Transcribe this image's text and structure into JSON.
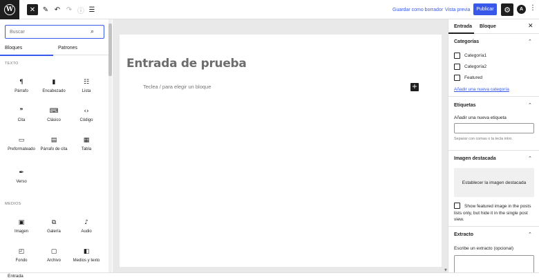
{
  "toolbar": {
    "save_draft": "Guardar como borrador",
    "preview": "Vista previa",
    "publish": "Publicar",
    "avatar_letter": "A"
  },
  "inserter": {
    "search_placeholder": "Buscar",
    "tabs": [
      "Bloques",
      "Patrones"
    ],
    "categories": {
      "text": "TEXTO",
      "media": "MEDIOS"
    },
    "text_blocks": [
      {
        "label": "Párrafo",
        "icon": "paragraph-icon"
      },
      {
        "label": "Encabezado",
        "icon": "bookmark-icon"
      },
      {
        "label": "Lista",
        "icon": "list-icon"
      },
      {
        "label": "Cita",
        "icon": "quote-icon"
      },
      {
        "label": "Clásico",
        "icon": "keyboard-icon"
      },
      {
        "label": "Código",
        "icon": "code-icon"
      },
      {
        "label": "Preformateado",
        "icon": "preformatted-icon"
      },
      {
        "label": "Párrafo de cita",
        "icon": "pullquote-icon"
      },
      {
        "label": "Tabla",
        "icon": "table-icon"
      },
      {
        "label": "Verso",
        "icon": "verse-icon"
      }
    ],
    "media_blocks": [
      {
        "label": "Imagen",
        "icon": "image-icon"
      },
      {
        "label": "Galería",
        "icon": "gallery-icon"
      },
      {
        "label": "Audio",
        "icon": "audio-icon"
      },
      {
        "label": "Fondo",
        "icon": "cover-icon"
      },
      {
        "label": "Archivo",
        "icon": "file-icon"
      },
      {
        "label": "Medios y texto",
        "icon": "media-text-icon"
      }
    ]
  },
  "editor": {
    "title": "Entrada de prueba",
    "placeholder": "Teclea / para elegir un bloque"
  },
  "sidebar": {
    "tabs": [
      "Entrada",
      "Bloque"
    ],
    "categories_title": "Categorías",
    "categories": [
      "Categoría1",
      "Categoría2",
      "Featured"
    ],
    "add_category": "Añadir una nueva categoría",
    "tags_title": "Etiquetas",
    "add_tag_label": "Añadir una nueva etiqueta",
    "tags_help": "Separar con comas o la tecla intro.",
    "featured_title": "Imagen destacada",
    "set_featured": "Establecer la imagen destacada",
    "featured_option": "Show featured image in the posts lists only, but hide it in the single post view.",
    "excerpt_title": "Extracto",
    "excerpt_label": "Escribe un extracto (opcional)"
  },
  "footer": {
    "breadcrumb": "Entrada"
  }
}
